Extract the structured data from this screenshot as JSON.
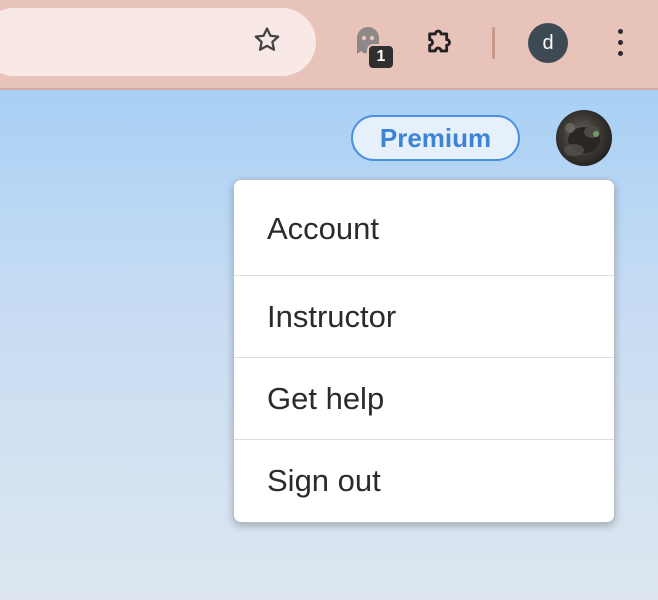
{
  "browser": {
    "extension_badge_count": "1",
    "profile_initial": "d",
    "icons": [
      "star-icon",
      "ghost-extension-icon",
      "puzzle-extensions-icon",
      "more-vert-icon"
    ]
  },
  "header": {
    "premium_label": "Premium"
  },
  "account_menu": {
    "items": [
      {
        "label": "Account"
      },
      {
        "label": "Instructor"
      },
      {
        "label": "Get help"
      },
      {
        "label": "Sign out"
      }
    ]
  },
  "colors": {
    "toolbar": "#e8c3b9",
    "accent": "#4a90e2",
    "page_gradient_top": "#a8d0f5",
    "page_gradient_bottom": "#dde6f0"
  }
}
